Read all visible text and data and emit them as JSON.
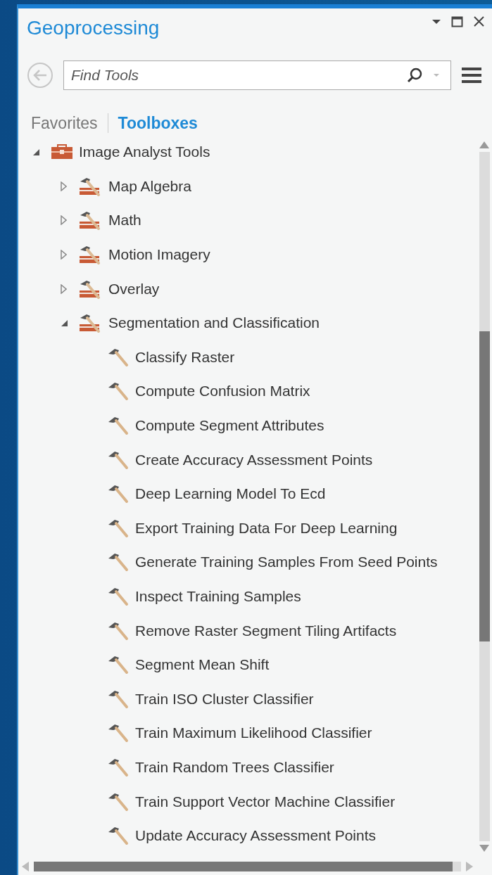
{
  "pane": {
    "title": "Geoprocessing"
  },
  "search": {
    "placeholder": "Find Tools"
  },
  "tabs": [
    {
      "label": "Favorites",
      "selected": false
    },
    {
      "label": "Toolboxes",
      "selected": true
    }
  ],
  "tree": [
    {
      "kind": "toolbox",
      "label": "Image Analyst Tools",
      "expanded": true,
      "children": [
        {
          "kind": "toolset",
          "label": "Map Algebra",
          "expanded": false
        },
        {
          "kind": "toolset",
          "label": "Math",
          "expanded": false
        },
        {
          "kind": "toolset",
          "label": "Motion Imagery",
          "expanded": false
        },
        {
          "kind": "toolset",
          "label": "Overlay",
          "expanded": false
        },
        {
          "kind": "toolset",
          "label": "Segmentation and Classification",
          "expanded": true,
          "children": [
            {
              "kind": "tool",
              "label": "Classify Raster"
            },
            {
              "kind": "tool",
              "label": "Compute Confusion Matrix"
            },
            {
              "kind": "tool",
              "label": "Compute Segment Attributes"
            },
            {
              "kind": "tool",
              "label": "Create Accuracy Assessment Points"
            },
            {
              "kind": "tool",
              "label": "Deep Learning Model To Ecd"
            },
            {
              "kind": "tool",
              "label": "Export Training Data For Deep Learning"
            },
            {
              "kind": "tool",
              "label": "Generate Training Samples From Seed Points"
            },
            {
              "kind": "tool",
              "label": "Inspect Training Samples"
            },
            {
              "kind": "tool",
              "label": "Remove Raster Segment Tiling Artifacts"
            },
            {
              "kind": "tool",
              "label": "Segment Mean Shift"
            },
            {
              "kind": "tool",
              "label": "Train ISO Cluster Classifier"
            },
            {
              "kind": "tool",
              "label": "Train Maximum Likelihood Classifier"
            },
            {
              "kind": "tool",
              "label": "Train Random Trees Classifier"
            },
            {
              "kind": "tool",
              "label": "Train Support Vector Machine Classifier"
            },
            {
              "kind": "tool",
              "label": "Update Accuracy Assessment Points"
            }
          ]
        }
      ]
    }
  ]
}
